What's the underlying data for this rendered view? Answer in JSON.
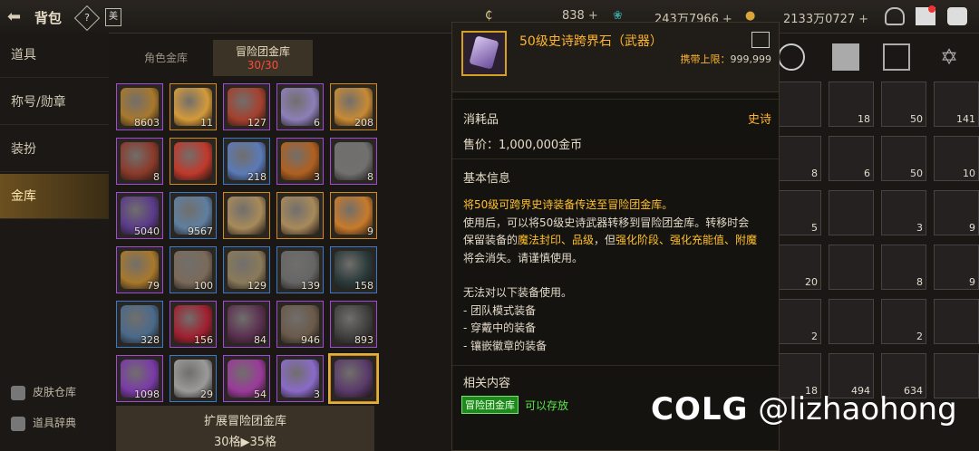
{
  "header": {
    "title": "背包",
    "help_label": "?",
    "book_label": "美",
    "currency1": "838",
    "currency2": "243万7966",
    "currency3": "2133万0727",
    "plus": "+"
  },
  "sidebar": {
    "items": [
      {
        "label": "道具"
      },
      {
        "label": "称号/勋章"
      },
      {
        "label": "装扮"
      },
      {
        "label": "金库"
      }
    ],
    "bottom": [
      {
        "label": "皮肤仓库"
      },
      {
        "label": "道具辞典"
      }
    ]
  },
  "tabs": {
    "char_vault": "角色金库",
    "adv_vault": "冒险团金库",
    "adv_count": "30/30"
  },
  "grid": {
    "quantities": [
      "8603",
      "11",
      "127",
      "6",
      "208",
      "8",
      "",
      "218",
      "3",
      "8",
      "5040",
      "9567",
      "",
      "",
      "9",
      "79",
      "100",
      "129",
      "139",
      "158",
      "328",
      "156",
      "84",
      "946",
      "893",
      "1098",
      "29",
      "54",
      "3",
      ""
    ],
    "colors": [
      "#a8782c",
      "#d49a3a",
      "#a5402e",
      "#8c7fb8",
      "#c88a34",
      "#8a3a2a",
      "#c0392b",
      "#5a7ab8",
      "#b06020",
      "#707070",
      "#5a3a8a",
      "#5f7fa0",
      "#a88a5a",
      "#a88a5a",
      "#c87a2a",
      "#a8782c",
      "#7a6a5a",
      "#8a7a5a",
      "#666666",
      "#2a3a3a",
      "#4a6a8a",
      "#a02030",
      "#5a3050",
      "#6a5a4a",
      "#404040",
      "#7a3aa8",
      "#9a9a9a",
      "#9a3a9a",
      "#8a6ac8",
      "#5a3a6a"
    ],
    "borders": [
      "epic",
      "legend",
      "epic",
      "epic",
      "legend",
      "epic",
      "legend",
      "rare",
      "epic",
      "epic",
      "epic",
      "rare",
      "legend",
      "legend",
      "legend",
      "epic",
      "rare",
      "rare",
      "rare",
      "rare",
      "rare",
      "epic",
      "epic",
      "epic",
      "epic",
      "epic",
      "rare",
      "epic",
      "epic",
      "legend"
    ]
  },
  "expand": {
    "title": "扩展冒险团金库",
    "detail": "30格▶35格"
  },
  "right_grid": {
    "quantities": [
      "",
      "18",
      "50",
      "141",
      "8",
      "6",
      "50",
      "10",
      "5",
      "",
      "3",
      "9",
      "20",
      "",
      "8",
      "9",
      "2",
      "",
      "2",
      "",
      "18",
      "494",
      "634",
      ""
    ]
  },
  "tooltip": {
    "name": "50级史诗跨界石（武器）",
    "limit_label": "携带上限：",
    "limit_value": "999,999",
    "category": "消耗品",
    "rarity": "史诗",
    "price": "售价：1,000,000金币",
    "basic_info": "基本信息",
    "desc_line1": "将50级可跨界史诗装备传送至冒险团金库。",
    "desc_line2": "使用后，可以将50级史诗武器转移到冒险团金库。转移时会",
    "desc_line3a": "保留装备的",
    "desc_line3b": "魔法封印、品级",
    "desc_line3c": "，但",
    "desc_line3d": "强化阶段、强化充能值、附魔",
    "desc_line4": "将会消失。请谨慎使用。",
    "cannot_use": "无法对以下装备使用。",
    "cannot1": "- 团队模式装备",
    "cannot2": "- 穿戴中的装备",
    "cannot3": "- 镶嵌徽章的装备",
    "related": "相关内容",
    "related_tag": "冒险团金库",
    "related_status": "可以存放"
  },
  "watermark": {
    "brand": "COLG",
    "user": "@lizhaohong"
  }
}
